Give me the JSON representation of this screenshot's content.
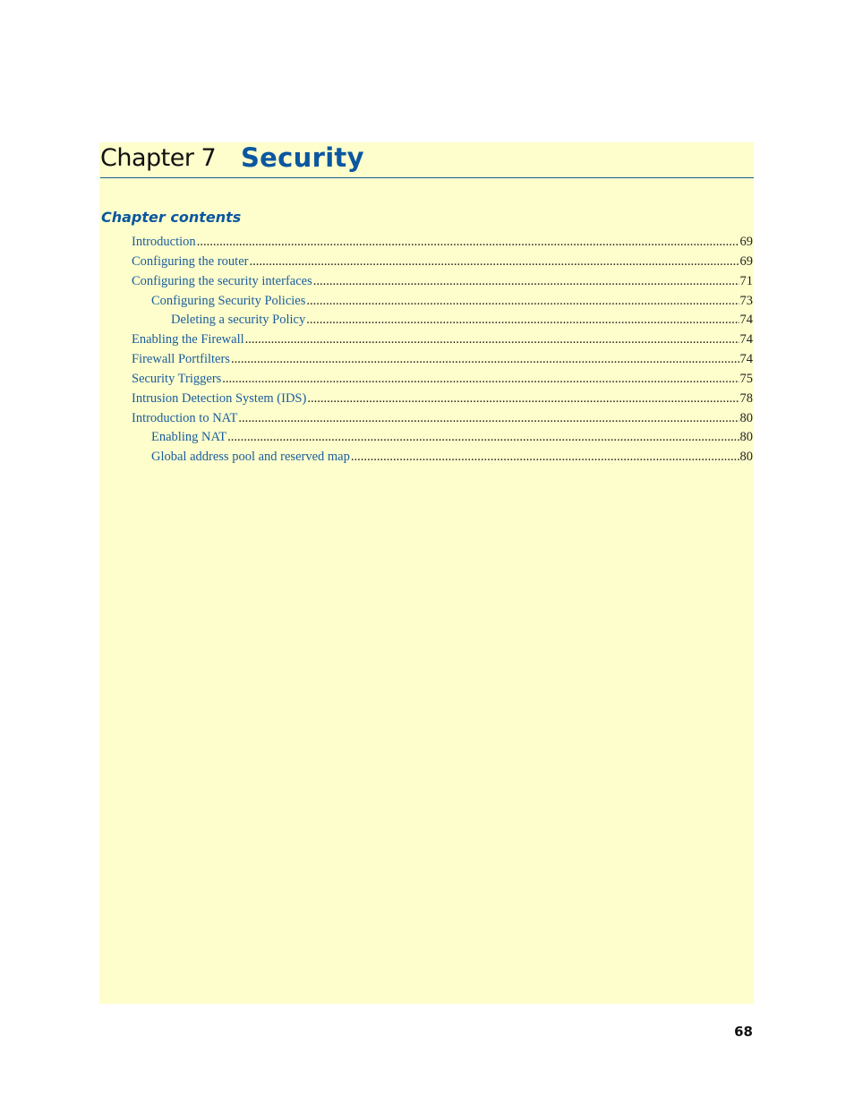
{
  "chapter": {
    "label": "Chapter 7",
    "title": "Security"
  },
  "contents": {
    "heading": "Chapter contents",
    "entries": [
      {
        "text": "Introduction",
        "page": "69",
        "level": 0
      },
      {
        "text": "Configuring the router",
        "page": "69",
        "level": 0
      },
      {
        "text": "Configuring the security interfaces",
        "page": "71",
        "level": 0
      },
      {
        "text": "Configuring Security Policies",
        "page": "73",
        "level": 1
      },
      {
        "text": "Deleting a security Policy",
        "page": "74",
        "level": 2
      },
      {
        "text": "Enabling the Firewall",
        "page": "74",
        "level": 0
      },
      {
        "text": "Firewall Portfilters",
        "page": "74",
        "level": 0
      },
      {
        "text": "Security Triggers",
        "page": "75",
        "level": 0
      },
      {
        "text": "Intrusion Detection System (IDS)",
        "page": "78",
        "level": 0
      },
      {
        "text": "Introduction to NAT",
        "page": "80",
        "level": 0
      },
      {
        "text": "Enabling NAT",
        "page": "80",
        "level": 1
      },
      {
        "text": "Global address pool and reserved map",
        "page": "80",
        "level": 1
      }
    ]
  },
  "footer": {
    "page_number": "68"
  },
  "colors": {
    "accent": "#0b57a0",
    "panel_background": "#fefecc",
    "link_text": "#1a5d9e"
  }
}
